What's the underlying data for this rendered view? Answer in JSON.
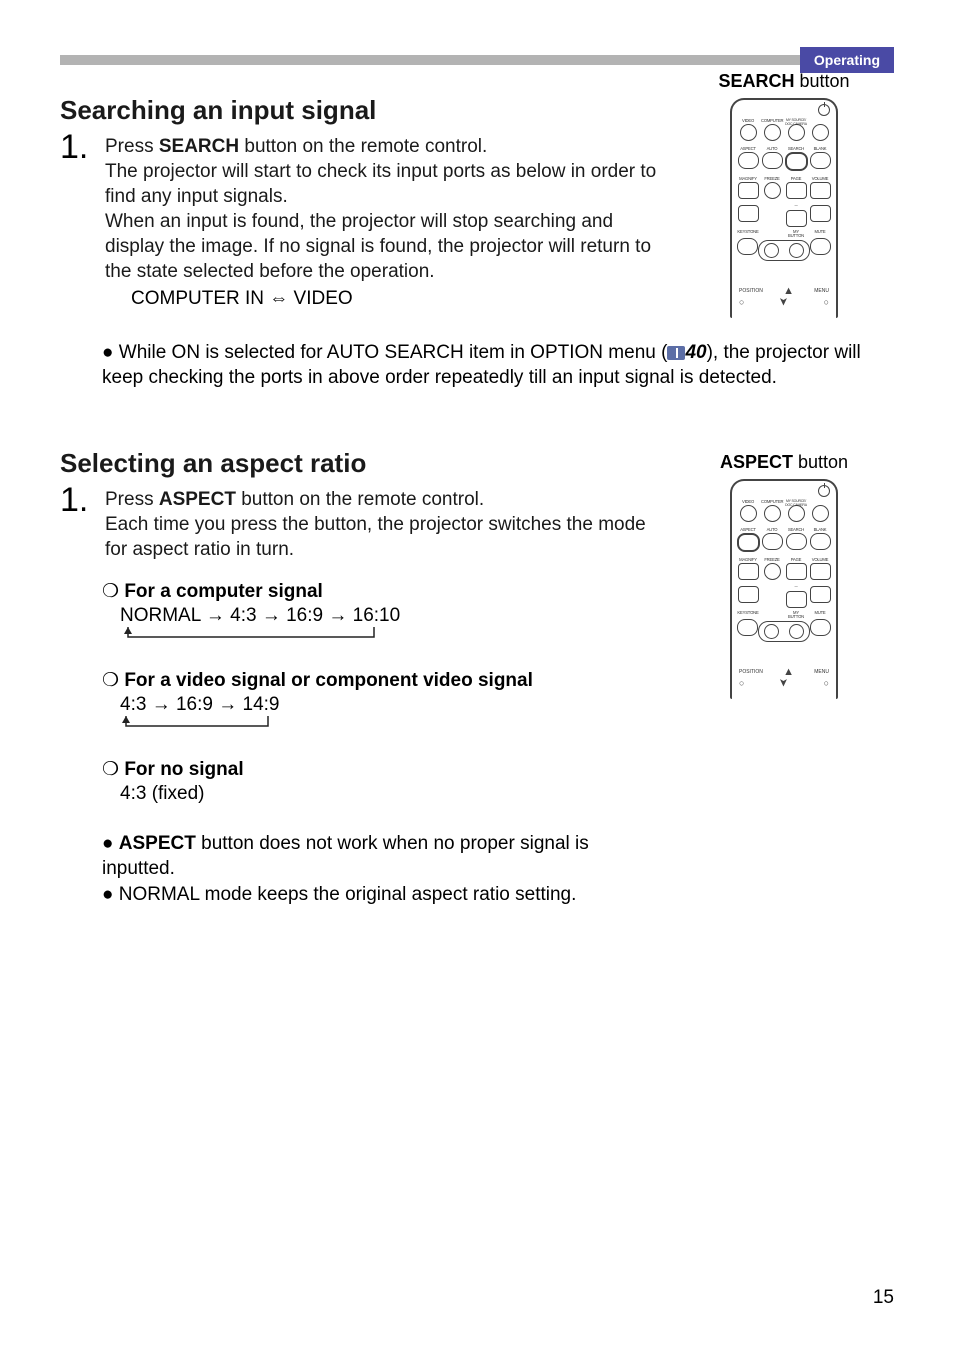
{
  "header": {
    "tab": "Operating"
  },
  "section1": {
    "title": "Searching an input signal",
    "caption": "SEARCH button",
    "caption_strong": "SEARCH",
    "caption_rest": " button",
    "step1_a": "Press ",
    "step1_b": "SEARCH",
    "step1_c": " button on the remote control.",
    "step1_para": "The projector will start to check its input ports as below in order to find any input signals.\nWhen an input is found, the projector will stop searching and display the image. If no signal is found, the projector will return to the state selected before the operation.",
    "sequence": "COMPUTER IN  ⇔  VIDEO",
    "bullet1_a": "● While ON is selected for AUTO SEARCH item in OPTION menu (",
    "bullet1_ref": "40",
    "bullet1_b": "), the projector will keep checking the ports in above order repeatedly till an input signal is detected."
  },
  "section2": {
    "title": "Selecting an aspect ratio",
    "caption_strong": "ASPECT",
    "caption_rest": " button",
    "step1_a": "Press ",
    "step1_b": "ASPECT",
    "step1_c": " button on the remote control.",
    "step1_para": "Each time you press the button, the projector switches the mode for aspect ratio in turn.",
    "sub1_label": "For a computer signal",
    "sub1_seq": "NORMAL  →  4:3  →  16:9  →  16:10",
    "sub2_label": "For a video signal or component video signal",
    "sub2_seq": "4:3  →  16:9  →  14:9",
    "sub3_label": "For no signal",
    "sub3_seq": "4:3 (fixed)",
    "bullet2_a": "● ",
    "bullet2_b": "ASPECT",
    "bullet2_c": " button does not work when no proper signal is inputted.",
    "bullet3": "● NORMAL mode keeps the original aspect ratio setting."
  },
  "remote_labels": {
    "r1": [
      "VIDEO",
      "COMPUTER",
      "MY SOURCE/\nDOC.CAMERA",
      ""
    ],
    "r2": [
      "ASPECT",
      "AUTO",
      "SEARCH",
      "BLANK"
    ],
    "r3": [
      "MAGNIFY",
      "FREEZE",
      "PAGE",
      "VOLUME"
    ],
    "r4": [
      "KEYSTONE",
      "",
      "MY BUTTON",
      "MUTE"
    ],
    "bottom_left": "POSITION",
    "bottom_right": "MENU"
  },
  "page_number": "15"
}
